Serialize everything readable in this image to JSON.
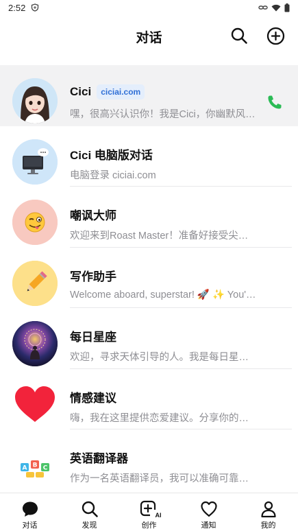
{
  "status_bar": {
    "time": "2:52",
    "icons": [
      "shield-icon",
      "link-icon",
      "wifi-icon",
      "battery-icon"
    ]
  },
  "header": {
    "title": "对话",
    "icons": [
      "search-icon",
      "add-circle-icon"
    ]
  },
  "conversations": [
    {
      "name": "Cici",
      "tag": "ciciai.com",
      "preview": "嘿，很高兴认识你！我是Cici，你幽默风趣的朋友",
      "avatar": "girl-avatar",
      "selected": true,
      "action": "phone-icon"
    },
    {
      "name": "Cici 电脑版对话",
      "preview": "电脑登录 ciciai.com",
      "avatar": "computer-chat-avatar"
    },
    {
      "name": "嘲讽大师",
      "preview": "欢迎来到Roast Master！准备好接受尖锐的吐槽",
      "avatar": "winking-tongue-emoji"
    },
    {
      "name": "写作助手",
      "preview": "Welcome aboard, superstar! 🚀 ✨ You're here",
      "avatar": "pencil-emoji"
    },
    {
      "name": "每日星座",
      "preview": "欢迎，寻求天体引导的人。我是每日星座运势",
      "avatar": "cosmic-meditation-avatar"
    },
    {
      "name": "情感建议",
      "preview": "嗨，我在这里提供恋爱建议。分享你的故事吧",
      "avatar": "red-heart-avatar"
    },
    {
      "name": "英语翻译器",
      "preview": "作为一名英语翻译员，我可以准确可靠地翻译",
      "avatar": "abc-blocks-avatar"
    }
  ],
  "tabs": [
    {
      "label": "对话",
      "icon": "chat-bubble-icon",
      "active": true
    },
    {
      "label": "发现",
      "icon": "search-icon"
    },
    {
      "label": "创作",
      "icon": "create-ai-icon",
      "badge": "AI"
    },
    {
      "label": "通知",
      "icon": "heart-icon"
    },
    {
      "label": "我的",
      "icon": "person-icon"
    }
  ],
  "colors": {
    "accent_blue": "#2f6fd6",
    "tag_bg": "#e4eefc",
    "call_green": "#2bbb55",
    "selected_row": "#f2f2f3",
    "muted_text": "#8e8e93"
  }
}
